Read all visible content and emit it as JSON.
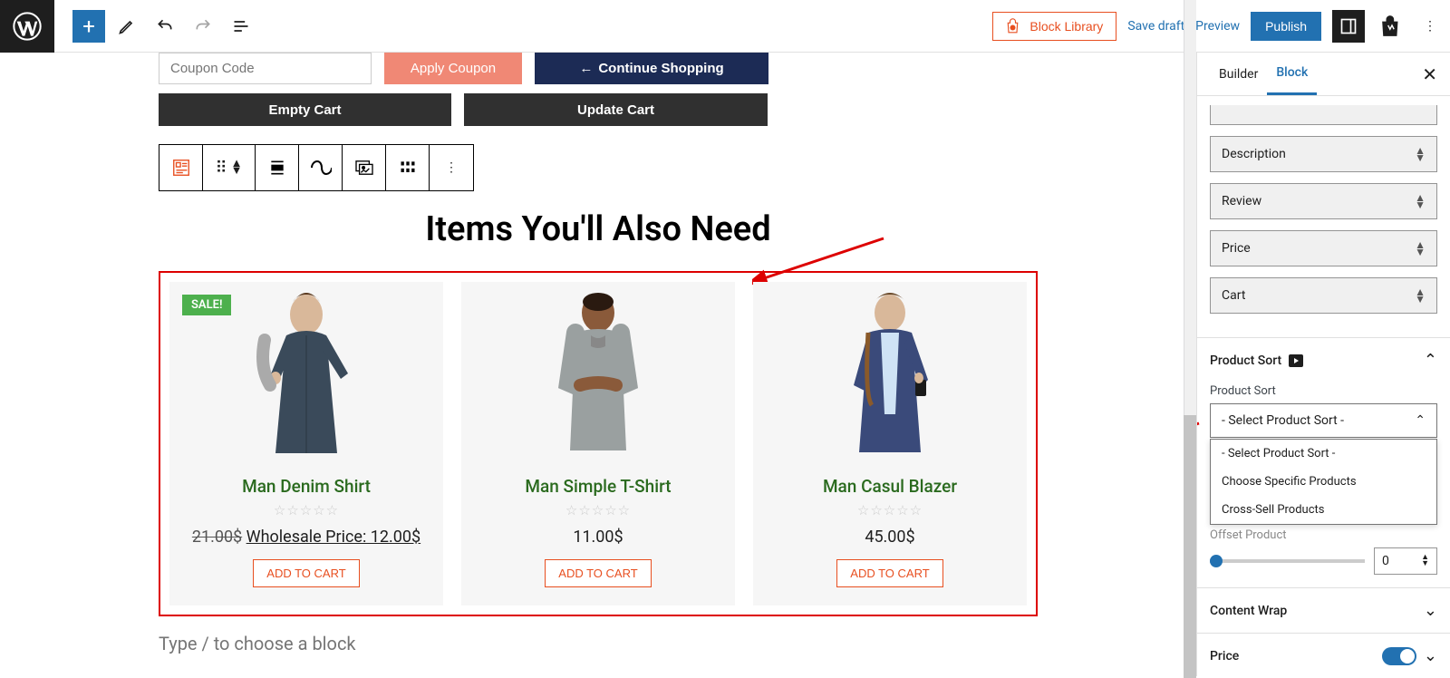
{
  "topbar": {
    "block_library": "Block Library",
    "save_draft": "Save draft",
    "preview": "Preview",
    "publish": "Publish"
  },
  "cart": {
    "coupon_placeholder": "Coupon Code",
    "apply_coupon": "Apply Coupon",
    "continue_shopping": "Continue Shopping",
    "empty_cart": "Empty Cart",
    "update_cart": "Update Cart"
  },
  "section_heading": "Items You'll Also Need",
  "products": [
    {
      "name": "Man Denim Shirt",
      "sale": "SALE!",
      "old_price": "21.00$",
      "wholesale": "Wholesale Price: 12.00$",
      "add": "ADD TO CART"
    },
    {
      "name": "Man Simple T-Shirt",
      "price": "11.00$",
      "add": "ADD TO CART"
    },
    {
      "name": "Man Casul Blazer",
      "price": "45.00$",
      "add": "ADD TO CART"
    }
  ],
  "prompt": "Type / to choose a block",
  "sidebar": {
    "tab_builder": "Builder",
    "tab_block": "Block",
    "selects": [
      "Description",
      "Review",
      "Price",
      "Cart"
    ],
    "product_sort_title": "Product Sort",
    "product_sort_label": "Product Sort",
    "product_sort_value": "- Select Product Sort -",
    "product_sort_options": [
      "- Select Product Sort -",
      "Choose Specific Products",
      "Cross-Sell Products"
    ],
    "offset_label": "Offset Product",
    "offset_value": "0",
    "content_wrap": "Content Wrap",
    "price": "Price"
  }
}
